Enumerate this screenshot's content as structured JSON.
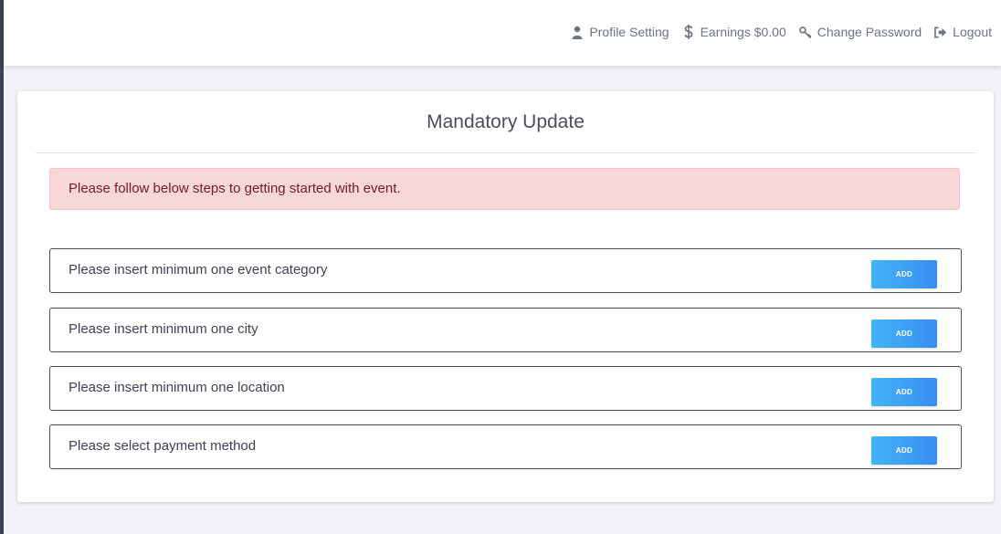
{
  "nav": {
    "items": [
      {
        "label": "Profile Setting",
        "icon": "user-icon"
      },
      {
        "label": "Earnings $0.00",
        "icon": "dollar-icon"
      },
      {
        "label": "Change Password",
        "icon": "key-icon"
      },
      {
        "label": "Logout",
        "icon": "logout-icon"
      }
    ]
  },
  "card": {
    "title": "Mandatory Update",
    "alert": "Please follow below steps to getting started with event."
  },
  "steps": [
    {
      "label": "Please insert minimum one event category",
      "button": "ADD"
    },
    {
      "label": "Please insert minimum one city",
      "button": "ADD"
    },
    {
      "label": "Please insert minimum one location",
      "button": "ADD"
    },
    {
      "label": "Please select payment method",
      "button": "ADD"
    }
  ],
  "colors": {
    "alert_bg": "#f8d7da",
    "alert_text": "#721c24",
    "button_start": "#42b4f8",
    "button_end": "#3a8ef0"
  }
}
